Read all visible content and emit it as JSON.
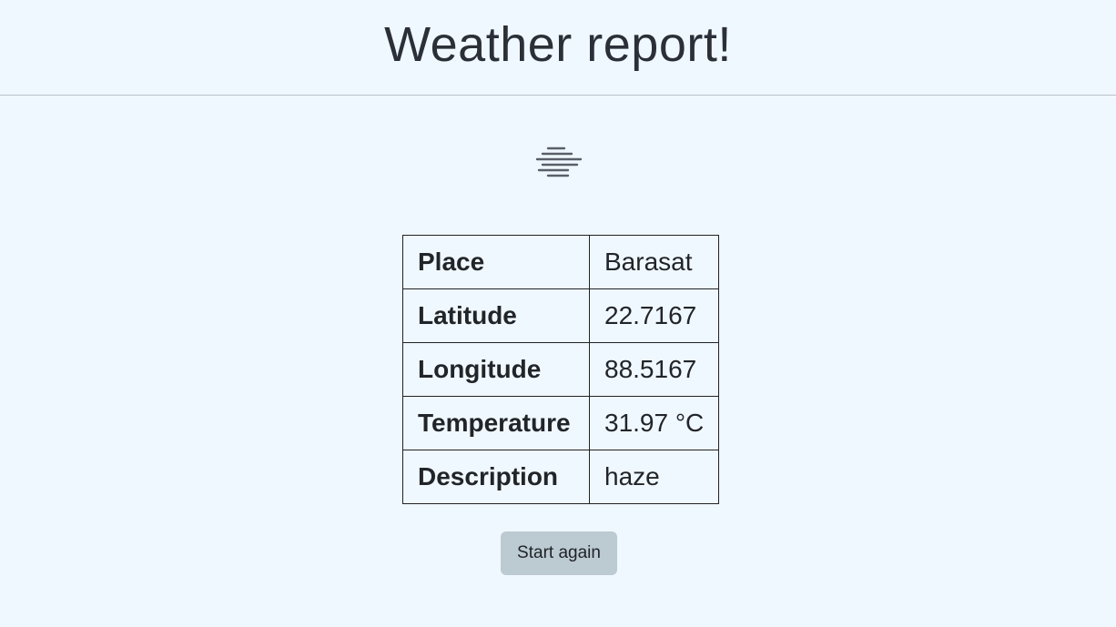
{
  "header": {
    "title": "Weather report!"
  },
  "weather_icon": {
    "name": "haze-icon",
    "color": "#4a4f57"
  },
  "table": {
    "rows": [
      {
        "label": "Place",
        "value": "Barasat"
      },
      {
        "label": "Latitude",
        "value": "22.7167"
      },
      {
        "label": "Longitude",
        "value": "88.5167"
      },
      {
        "label": "Temperature",
        "value": "31.97 °C"
      },
      {
        "label": "Description",
        "value": "haze"
      }
    ]
  },
  "actions": {
    "restart_label": "Start again"
  },
  "colors": {
    "background": "#f0f8ff",
    "button": "#bccad2",
    "text": "#212529"
  }
}
